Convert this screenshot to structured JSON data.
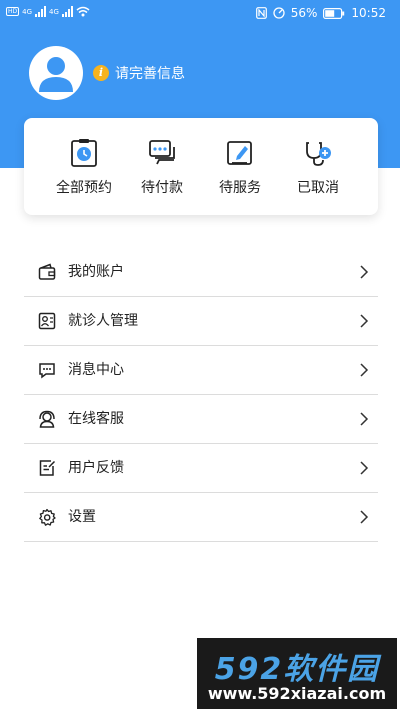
{
  "status_bar": {
    "sim_tags": [
      "HD",
      "HD"
    ],
    "network_tags": [
      "4G",
      "4G"
    ],
    "battery": "56%",
    "time": "10:52",
    "text_color": "#ffffff"
  },
  "profile": {
    "prompt": "请完善信息",
    "info_badge_glyph": "i",
    "info_badge_color": "#f6b31f",
    "avatar_icon": "user-avatar-icon"
  },
  "orders": [
    {
      "label": "全部预约",
      "icon": "appointment-clock-icon"
    },
    {
      "label": "待付款",
      "icon": "chat-payment-icon"
    },
    {
      "label": "待服务",
      "icon": "service-edit-icon"
    },
    {
      "label": "已取消",
      "icon": "stethoscope-icon"
    }
  ],
  "menu": [
    {
      "label": "我的账户",
      "icon": "wallet-icon"
    },
    {
      "label": "就诊人管理",
      "icon": "id-card-icon"
    },
    {
      "label": "消息中心",
      "icon": "message-icon"
    },
    {
      "label": "在线客服",
      "icon": "customer-service-icon"
    },
    {
      "label": "用户反馈",
      "icon": "feedback-icon"
    },
    {
      "label": "设置",
      "icon": "gear-icon"
    }
  ],
  "watermark": {
    "brand": "592软件园",
    "url": "www.592xiazai.com"
  },
  "colors": {
    "header": "#3d97f3",
    "accent_blue": "#3d97f3",
    "divider": "#dcdcdc"
  }
}
